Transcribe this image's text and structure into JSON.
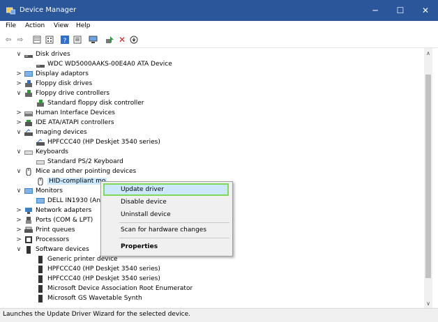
{
  "window": {
    "title": "Device Manager",
    "minimize": "─",
    "maximize": "☐",
    "close": "✕"
  },
  "menu": {
    "file": "File",
    "action": "Action",
    "view": "View",
    "help": "Help"
  },
  "toolbar": {
    "icons": [
      "back-arrow-icon",
      "forward-arrow-icon",
      "properties-icon",
      "grid-view-icon",
      "help-icon",
      "list-view-icon",
      "computer-icon",
      "add-driver-icon",
      "remove-icon",
      "download-icon"
    ]
  },
  "tree": {
    "rows": [
      {
        "label": "Disk drives",
        "toggle": "∨",
        "level": 0
      },
      {
        "label": "WDC WD5000AAKS-00E4A0 ATA Device",
        "toggle": "",
        "level": 1
      },
      {
        "label": "Display adaptors",
        "toggle": ">",
        "level": 0
      },
      {
        "label": "Floppy disk drives",
        "toggle": ">",
        "level": 0
      },
      {
        "label": "Floppy drive controllers",
        "toggle": "∨",
        "level": 0
      },
      {
        "label": "Standard floppy disk controller",
        "toggle": "",
        "level": 1
      },
      {
        "label": "Human Interface Devices",
        "toggle": ">",
        "level": 0
      },
      {
        "label": "IDE ATA/ATAPI controllers",
        "toggle": ">",
        "level": 0
      },
      {
        "label": "Imaging devices",
        "toggle": "∨",
        "level": 0
      },
      {
        "label": "HPFCCC40 (HP Deskjet 3540 series)",
        "toggle": "",
        "level": 1
      },
      {
        "label": "Keyboards",
        "toggle": "∨",
        "level": 0
      },
      {
        "label": "Standard PS/2 Keyboard",
        "toggle": "",
        "level": 1
      },
      {
        "label": "Mice and other pointing devices",
        "toggle": "∨",
        "level": 0
      },
      {
        "label": "HID-compliant mo",
        "toggle": "",
        "level": 1
      },
      {
        "label": "Monitors",
        "toggle": "∨",
        "level": 0
      },
      {
        "label": "DELL IN1930 (Anal",
        "toggle": "",
        "level": 1
      },
      {
        "label": "Network adapters",
        "toggle": ">",
        "level": 0
      },
      {
        "label": "Ports (COM & LPT)",
        "toggle": ">",
        "level": 0
      },
      {
        "label": "Print queues",
        "toggle": ">",
        "level": 0
      },
      {
        "label": "Processors",
        "toggle": ">",
        "level": 0
      },
      {
        "label": "Software devices",
        "toggle": "∨",
        "level": 0
      },
      {
        "label": "Generic printer device",
        "toggle": "",
        "level": 1
      },
      {
        "label": "HPFCCC40 (HP Deskjet 3540 series)",
        "toggle": "",
        "level": 1
      },
      {
        "label": "HPFCCC40 (HP Deskjet 3540 series)",
        "toggle": "",
        "level": 1
      },
      {
        "label": "Microsoft Device Association Root Enumerator",
        "toggle": "",
        "level": 1
      },
      {
        "label": "Microsoft GS Wavetable Synth",
        "toggle": "",
        "level": 1
      }
    ]
  },
  "context_menu": {
    "update_driver": "Update driver",
    "disable_device": "Disable device",
    "uninstall_device": "Uninstall device",
    "scan_hardware": "Scan for hardware changes",
    "properties": "Properties"
  },
  "status": {
    "text": "Launches the Update Driver Wizard for the selected device."
  },
  "colors": {
    "titlebar": "#2b579a",
    "highlight_border": "#7ed957",
    "selection": "#cce8ff"
  }
}
